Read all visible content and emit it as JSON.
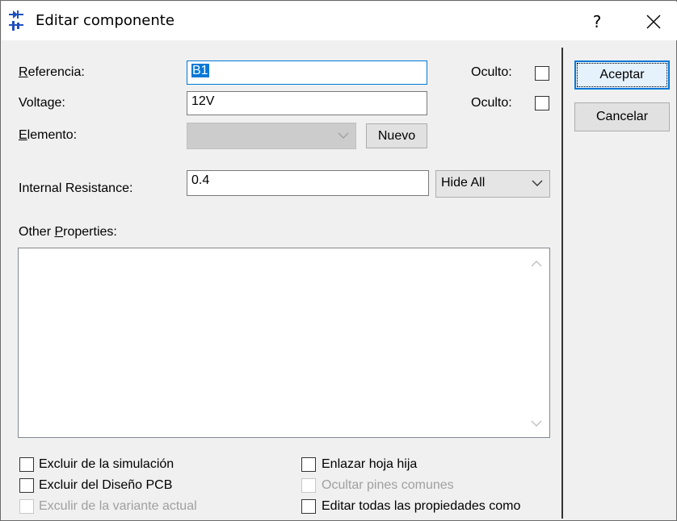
{
  "window": {
    "title": "Editar componente",
    "help_label": "?",
    "close_label": "X"
  },
  "fields": {
    "referencia": {
      "label": "Referencia:",
      "value": "B1",
      "hidden_label": "Oculto:",
      "hidden_checked": false
    },
    "voltage": {
      "label": "Voltage:",
      "value": "12V",
      "hidden_label": "Oculto:",
      "hidden_checked": false
    },
    "elemento": {
      "label": "Elemento:",
      "value": "",
      "enabled": false,
      "new_button": "Nuevo"
    },
    "internal_resistance": {
      "label": "Internal Resistance:",
      "value": "0.4",
      "visibility": "Hide All"
    }
  },
  "other_properties": {
    "label": "Other Properties:",
    "value": ""
  },
  "options": {
    "left": [
      {
        "label": "Excluir de la simulación",
        "checked": false,
        "enabled": true
      },
      {
        "label": "Excluir del Diseño PCB",
        "checked": false,
        "enabled": true
      },
      {
        "label": "Exculir de la variante actual",
        "checked": false,
        "enabled": false
      }
    ],
    "right": [
      {
        "label": "Enlazar hoja hija",
        "checked": false,
        "enabled": true
      },
      {
        "label": "Ocultar pines comunes",
        "checked": false,
        "enabled": false
      },
      {
        "label": "Editar todas las propiedades como",
        "checked": false,
        "enabled": true
      }
    ]
  },
  "buttons": {
    "ok": "Aceptar",
    "cancel": "Cancelar"
  },
  "colors": {
    "accent": "#0078d7",
    "dialog_bg": "#f0f0f0",
    "disabled_text": "#a0a0a0"
  }
}
